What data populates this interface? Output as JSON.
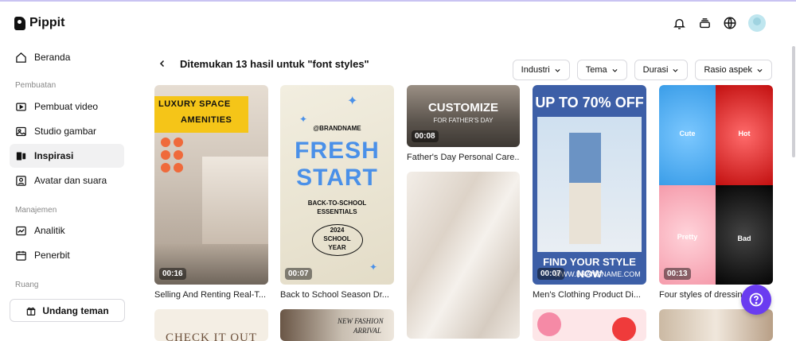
{
  "app": {
    "name": "Pippit"
  },
  "sidebar": {
    "home": "Beranda",
    "sections": {
      "create": "Pembuatan",
      "manage": "Manajemen",
      "space": "Ruang"
    },
    "items": [
      {
        "label": "Pembuat video"
      },
      {
        "label": "Studio gambar"
      },
      {
        "label": "Inspirasi"
      },
      {
        "label": "Avatar dan suara"
      },
      {
        "label": "Analitik"
      },
      {
        "label": "Penerbit"
      }
    ],
    "invite": "Undang teman"
  },
  "main": {
    "results_title": "Ditemukan 13 hasil untuk \"font styles\"",
    "filters": [
      {
        "label": "Industri"
      },
      {
        "label": "Tema"
      },
      {
        "label": "Durasi"
      },
      {
        "label": "Rasio aspek"
      }
    ],
    "cards": [
      {
        "title": "Selling And Renting Real-T...",
        "duration": "00:16",
        "text1": "LUXURY SPACE",
        "text2": "AMENITIES"
      },
      {
        "title": "Back to School Season Dr...",
        "duration": "00:07",
        "brand": "@BRANDNAME",
        "text1": "FRESH",
        "text2": "START",
        "sub1": "BACK-TO-SCHOOL",
        "sub2": "ESSENTIALS",
        "badge1": "2024",
        "badge2": "SCHOOL",
        "badge3": "YEAR"
      },
      {
        "title": "Father's Day Personal Care...",
        "duration": "00:08",
        "text1": "CUSTOMIZE",
        "text2": "FOR FATHER'S DAY"
      },
      {
        "title": "Men's Clothing Product Di...",
        "duration": "00:07",
        "text1": "UP TO 70% OFF",
        "text2": "FIND YOUR STYLE NOW",
        "text3": "WWW.BRANDNAME.COM"
      },
      {
        "title": "Four styles of dressin...",
        "duration": "00:13",
        "q1": "Cute",
        "q2": "Hot",
        "q3": "Pretty",
        "q4": "Bad"
      },
      {
        "text1": "CHECK IT OUT"
      },
      {
        "text1": "NEW FASHION",
        "text2": "ARRIVAL"
      }
    ]
  },
  "colors": {
    "accent": "#6a3cf0",
    "luxury_yellow": "#f5c518",
    "fresh_blue": "#4a90e8",
    "sale_navy": "#3d5fa7"
  }
}
